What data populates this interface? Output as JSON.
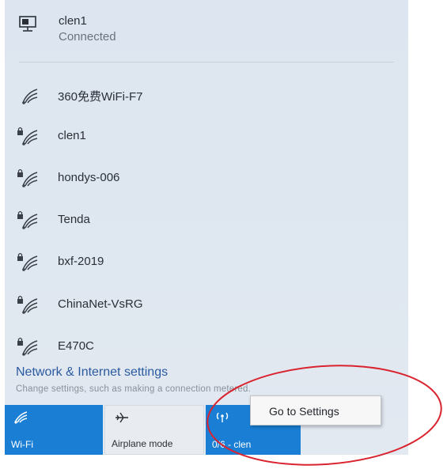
{
  "connected": {
    "name": "clen1",
    "status": "Connected"
  },
  "networks": [
    {
      "label": "360免费WiFi-F7",
      "secured": false
    },
    {
      "label": "clen1",
      "secured": true
    },
    {
      "label": "hondys-006",
      "secured": true
    },
    {
      "label": "Tenda",
      "secured": true
    },
    {
      "label": "bxf-2019",
      "secured": true
    },
    {
      "label": "ChinaNet-VsRG",
      "secured": true
    },
    {
      "label": "E470C",
      "secured": true
    }
  ],
  "settings": {
    "title": "Network & Internet settings",
    "subtitle": "Change settings, such as making a connection metered."
  },
  "tiles": [
    {
      "label": "Wi-Fi",
      "active": true,
      "icon": "wifi-icon"
    },
    {
      "label": "Airplane mode",
      "active": false,
      "icon": "airplane-icon"
    },
    {
      "label": "0/6 - clen",
      "active": true,
      "icon": "hotspot-icon"
    }
  ],
  "context_menu": {
    "item": "Go to Settings"
  },
  "colors": {
    "accent": "#1a7fd4",
    "link": "#2b5aa0",
    "annotation": "#d9232e",
    "panel": "#dfe7f0"
  }
}
